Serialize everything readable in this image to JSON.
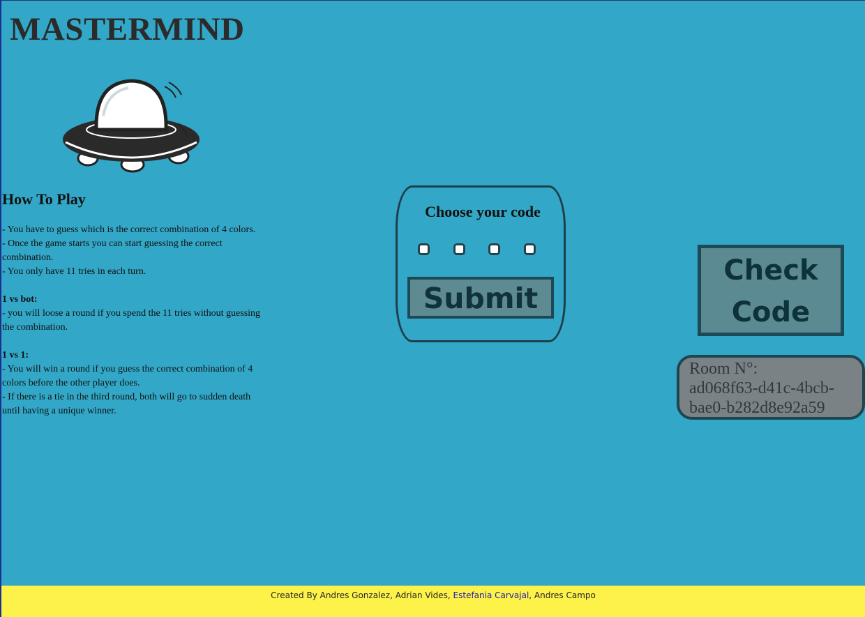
{
  "header": {
    "title": "MASTERMIND",
    "logo_icon": "ufo-icon"
  },
  "how_to_play": {
    "title": "How To Play",
    "rules": [
      "- You have to guess which is the correct combination of 4 colors.",
      "- Once the game starts you can start guessing the correct combination.",
      "- You only have 11 tries in each turn."
    ],
    "bot_title": "1 vs bot:",
    "bot_rules": [
      "- you will loose a round if you spend the 11 tries without guessing the combination."
    ],
    "pvp_title": "1 vs 1:",
    "pvp_rules": [
      "- You will win a round if you guess the correct combination of 4 colors before the other player does.",
      "- If there is a tie in the third round, both will go to sudden death until having a unique winner."
    ]
  },
  "code_panel": {
    "title": "Choose your code",
    "pegs": [
      "",
      "",
      "",
      ""
    ],
    "submit_label": "Submit"
  },
  "check_code": {
    "label_line1": "Check",
    "label_line2": "Code"
  },
  "room": {
    "label": "Room N°:",
    "id_part1": "ad068f63-d41c-4bcb-",
    "id_part2": "bae0-b282d8e92a59"
  },
  "footer": {
    "prefix": "Created By Andres Gonzalez, Adrian Vides, ",
    "highlight": "Estefania Carvajal",
    "suffix": ", Andres Campo"
  },
  "colors": {
    "background": "#32a7c7",
    "footer": "#fdf24a",
    "button_fill": "#5b8a92",
    "button_border": "#1d4a57",
    "room_fill": "#7b8286"
  }
}
